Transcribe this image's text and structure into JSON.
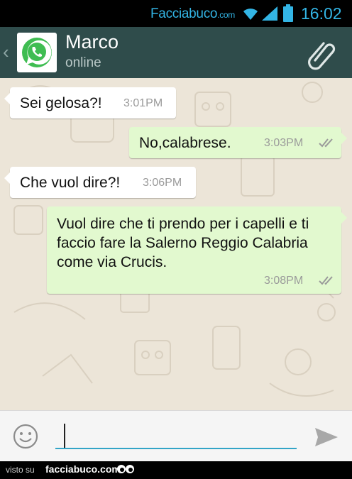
{
  "status_bar": {
    "brand_name": "Facciabuco",
    "brand_tld": ".com",
    "time": "16:02",
    "icons": [
      "wifi-icon",
      "signal-icon",
      "battery-icon"
    ],
    "accent_color": "#33b5e5"
  },
  "header": {
    "back_glyph": "‹",
    "contact_name": "Marco",
    "contact_status": "online",
    "avatar_icon": "whatsapp-logo-icon",
    "attach_icon": "paperclip-icon",
    "background_color": "#2f4c4b"
  },
  "messages": [
    {
      "direction": "in",
      "text": "Sei gelosa?!",
      "time": "3:01PM"
    },
    {
      "direction": "out",
      "text": "No,calabrese.",
      "time": "3:03PM",
      "status": "double-check-icon"
    },
    {
      "direction": "in",
      "text": "Che vuol dire?!",
      "time": "3:06PM"
    },
    {
      "direction": "out",
      "text": "Vuol dire che ti prendo per i capelli e ti faccio fare la Salerno Reggio Calabria come via Crucis.",
      "time": "3:08PM",
      "status": "double-check-icon"
    }
  ],
  "input_bar": {
    "emoji_icon": "smiley-icon",
    "message_value": "",
    "send_icon": "send-arrow-icon",
    "underline_color": "#33a5c7"
  },
  "footer": {
    "prefix": "visto su",
    "site": "facciabuco.com",
    "icon": "eyes-icon"
  }
}
